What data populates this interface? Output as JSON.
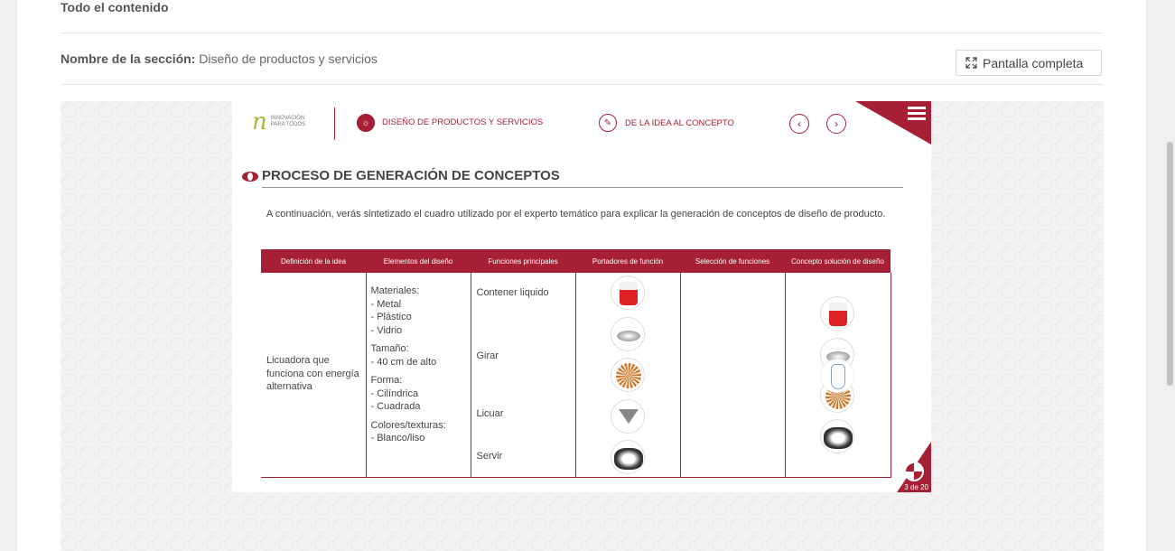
{
  "page": {
    "top_link": "Todo el contenido",
    "section_label": "Nombre de la sección:",
    "section_value": "Diseño de productos y servicios",
    "fullscreen_label": "Pantalla completa"
  },
  "slide": {
    "logo_line1": "INNOVACIÓN",
    "logo_line2": "PARA TODOS",
    "breadcrumb_1": "DISEÑO DE PRODUCTOS Y SERVICIOS",
    "breadcrumb_2": "DE LA IDEA AL CONCEPTO",
    "title": "PROCESO DE GENERACIÓN DE CONCEPTOS",
    "intro": "A continuación, verás sintetizado el cuadro utilizado por el experto temático para explicar la generación de conceptos de diseño de producto.",
    "page_indicator": "3 de 20",
    "accent_color": "#a61f35",
    "table": {
      "headers": [
        "Definición de la idea",
        "Elementos del diseño",
        "Funciones principales",
        "Portadores de función",
        "Selección de funciones",
        "Concepto solución de diseño"
      ],
      "idea": "Licuadora que funciona con energía alternativa",
      "elements": {
        "materials_title": "Materiales:",
        "materials": [
          "- Metal",
          "- Plástico",
          "- Vidrio"
        ],
        "size_title": "Tamaño:",
        "size": "- 40 cm de alto",
        "shape_title": "Forma:",
        "shapes": [
          "- Cilíndrica",
          "- Cuadrada"
        ],
        "colors_title": "Colores/texturas:",
        "colors": "- Blanco/liso"
      },
      "functions": [
        "Contener liquido",
        "Girar",
        "Licuar",
        "Servir"
      ],
      "carriers_icons": [
        "can-icon",
        "motor-icon",
        "coil-icon",
        "funnel-icon",
        "blade-icon"
      ],
      "selection_icons": [
        "can-icon",
        "motor-icon",
        "coil-icon",
        "blade-icon"
      ],
      "concept_icon": "blender-sketch-icon"
    }
  }
}
